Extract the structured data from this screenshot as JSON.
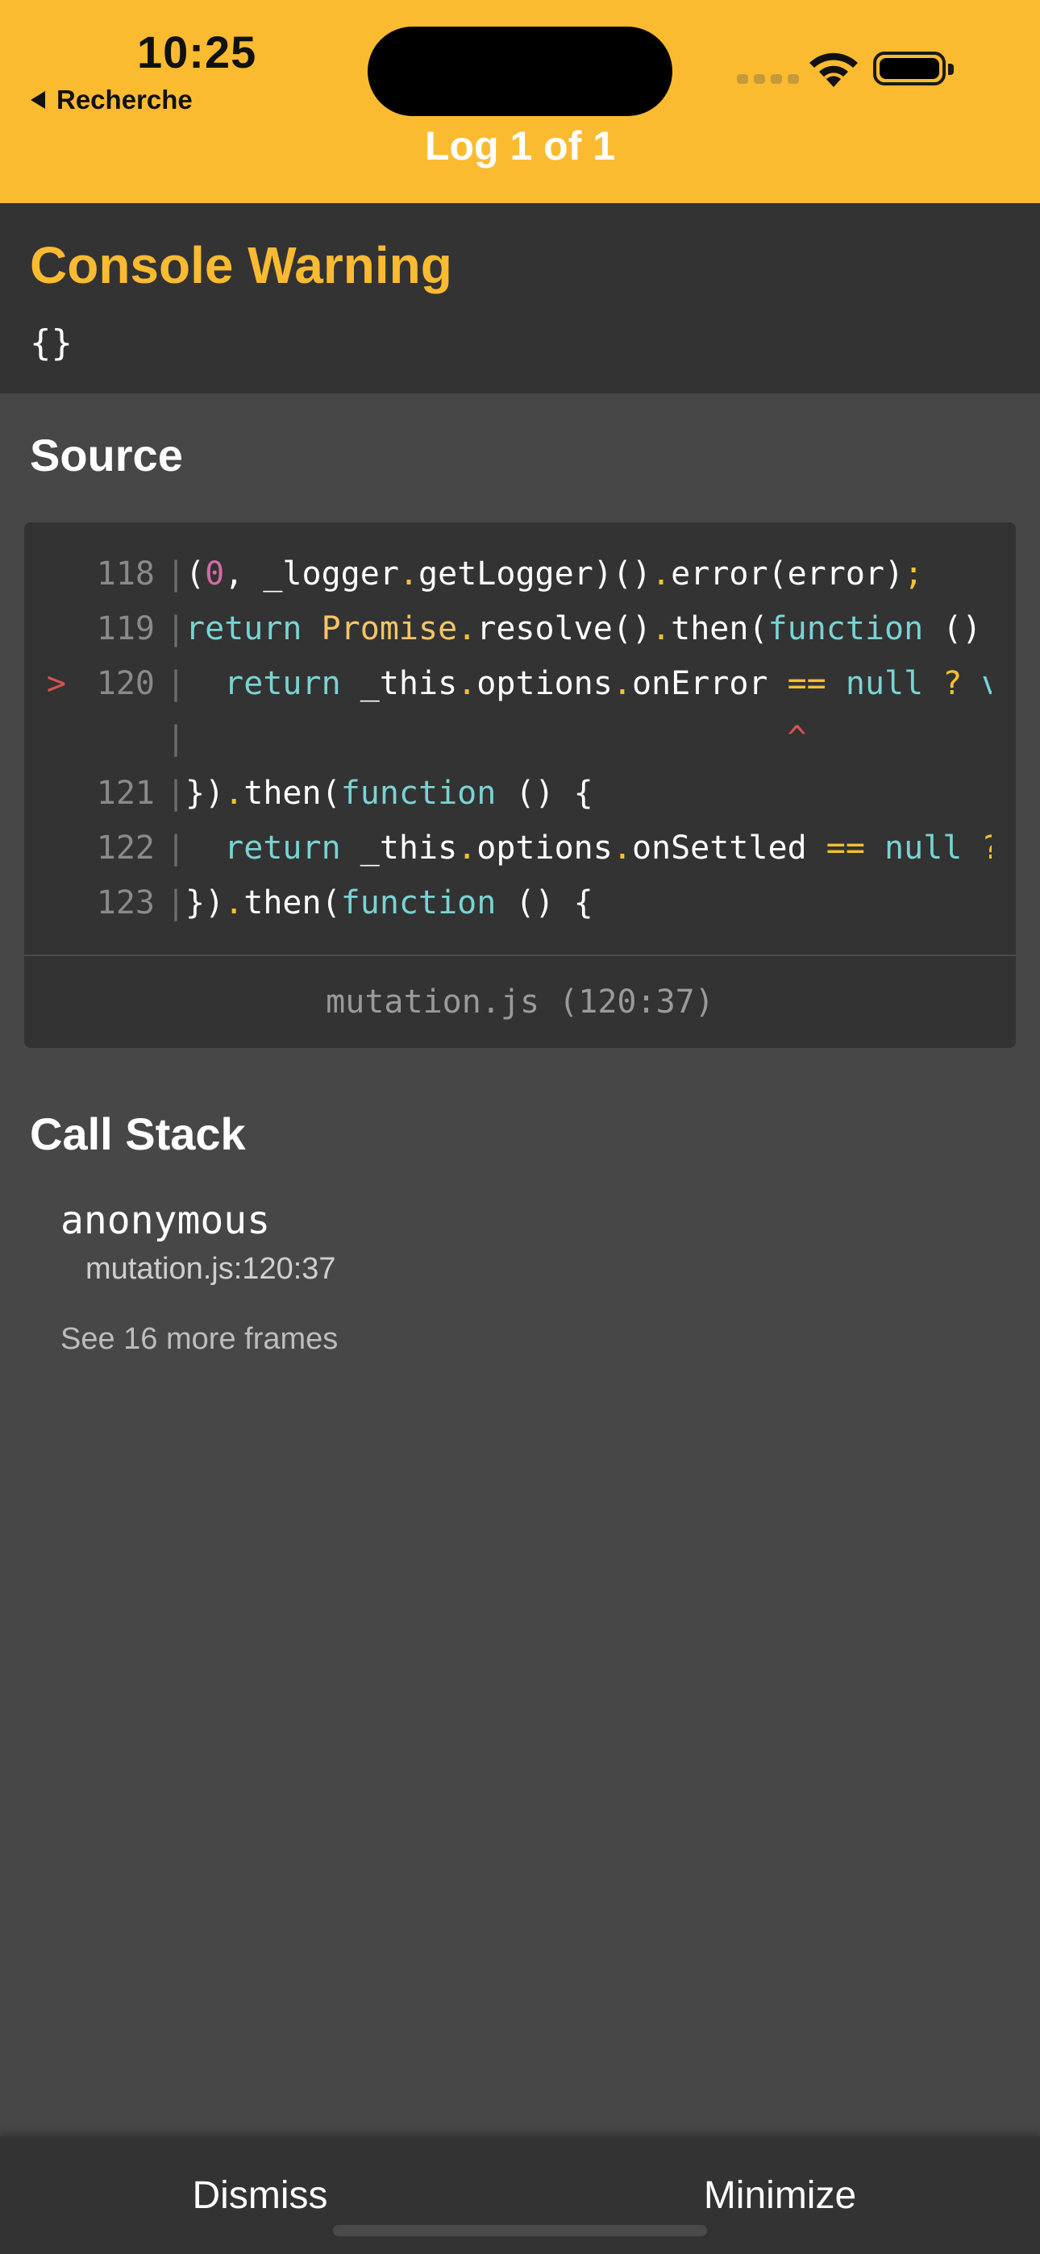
{
  "status_bar": {
    "time": "10:25",
    "back_label": "Recherche"
  },
  "header": {
    "title": "Log 1 of 1",
    "background_color": "#fbbb31"
  },
  "warning": {
    "title": "Console Warning",
    "message": "{}"
  },
  "source": {
    "title": "Source",
    "lines": [
      {
        "marker": "",
        "number": "118"
      },
      {
        "marker": "",
        "number": "119"
      },
      {
        "marker": ">",
        "number": "120"
      },
      {
        "marker": "",
        "number": ""
      },
      {
        "marker": "",
        "number": "121"
      },
      {
        "marker": "",
        "number": "122"
      },
      {
        "marker": "",
        "number": "123"
      }
    ],
    "code": [
      [
        "(",
        "0",
        ", _logger",
        ".",
        "getLogger)()",
        ".",
        "error(error)",
        ";"
      ],
      [
        "return",
        " ",
        "Promise",
        ".",
        "resolve()",
        ".",
        "then(",
        "function",
        " () {"
      ],
      [
        "  ",
        "return",
        " _this",
        ".",
        "options",
        ".",
        "onError ",
        "==",
        " ",
        "null",
        " ",
        "?",
        " ",
        "vc"
      ],
      [
        "                               ",
        "^"
      ],
      [
        "})",
        ".",
        "then(",
        "function",
        " () {"
      ],
      [
        "  ",
        "return",
        " _this",
        ".",
        "options",
        ".",
        "onSettled ",
        "==",
        " ",
        "null",
        " ",
        "?"
      ],
      [
        "})",
        ".",
        "then(",
        "function",
        " () {"
      ]
    ],
    "file_location": "mutation.js (120:37)"
  },
  "call_stack": {
    "title": "Call Stack",
    "frame_name": "anonymous",
    "frame_location": "mutation.js:120:37",
    "more_frames": "See 16 more frames"
  },
  "actions": {
    "dismiss": "Dismiss",
    "minimize": "Minimize"
  }
}
